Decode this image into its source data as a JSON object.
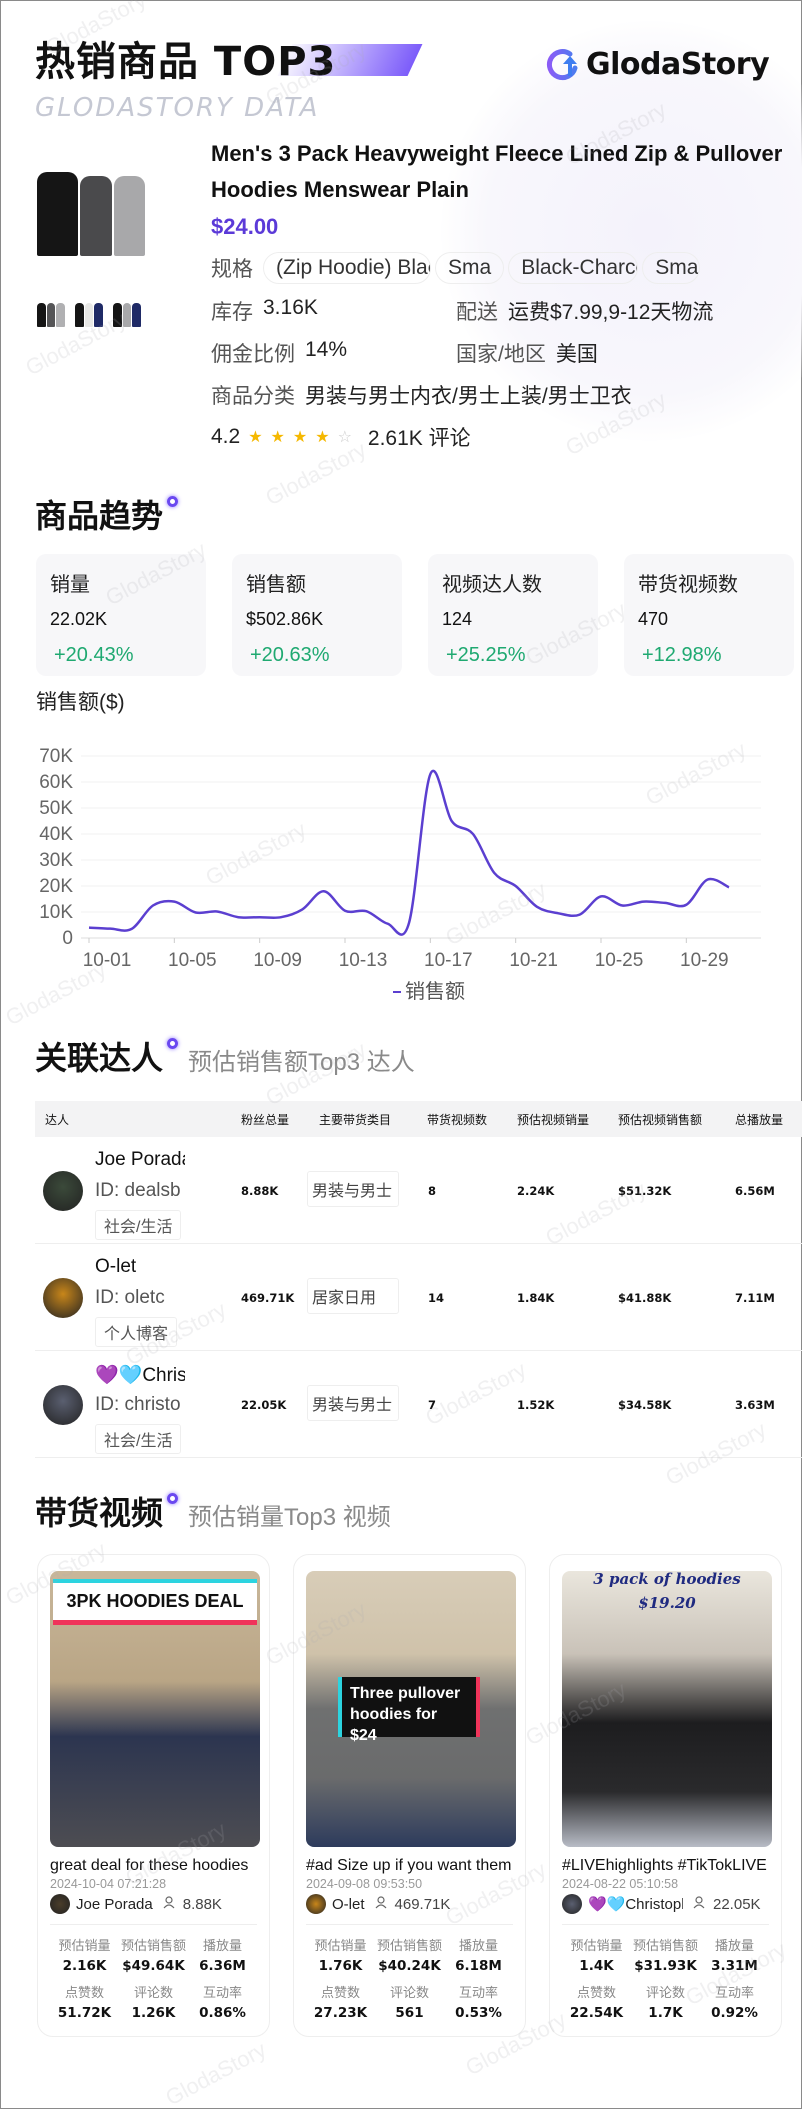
{
  "header": {
    "title": "热销商品 TOP3",
    "subtitle": "GLODASTORY DATA",
    "logo_text": "GlodaStory",
    "watermark": "GlodaStory",
    "accent_color": "#6a48f0"
  },
  "product": {
    "name": "Men's 3 Pack Heavyweight Fleece Lined Zip & Pullover Hoodies Menswear Plain",
    "price": "$24.00",
    "spec_label": "规格",
    "specs": [
      "(Zip Hoodie) Black-",
      "Sma",
      "Black-Charco",
      "Sma"
    ],
    "stock_label": "库存",
    "stock": "3.16K",
    "shipping_label": "配送",
    "shipping": "运费$7.99,9-12天物流",
    "commission_label": "佣金比例",
    "commission": "14%",
    "region_label": "国家/地区",
    "region": "美国",
    "category_label": "商品分类",
    "category": "男装与男士内衣/男士上装/男士卫衣",
    "rating": "4.2",
    "rating_stars": 4,
    "rating_max": 5,
    "reviews": "2.61K 评论",
    "image_colors": [
      "#151515",
      "#4a4a4c",
      "#a8a8aa"
    ],
    "variant_thumbs": [
      [
        "#151515",
        "#555557",
        "#b0b0b2"
      ],
      [
        "#151515",
        "#e8e8e6",
        "#1f2a66"
      ],
      [
        "#151515",
        "#a8a8aa",
        "#1f2a66"
      ]
    ]
  },
  "trend": {
    "title": "商品趋势",
    "metrics": [
      {
        "label": "销量",
        "value": "22.02K",
        "change": "+20.43%"
      },
      {
        "label": "销售额",
        "value": "$502.86K",
        "change": "+20.63%"
      },
      {
        "label": "视频达人数",
        "value": "124",
        "change": "+25.25%"
      },
      {
        "label": "带货视频数",
        "value": "470",
        "change": "+12.98%"
      }
    ],
    "positive_color": "#1fa971"
  },
  "chart_data": {
    "type": "line",
    "title": "销售额($)",
    "xlabel": "",
    "ylabel": "",
    "x": [
      "10-01",
      "10-02",
      "10-03",
      "10-04",
      "10-05",
      "10-06",
      "10-07",
      "10-08",
      "10-09",
      "10-10",
      "10-11",
      "10-12",
      "10-13",
      "10-14",
      "10-15",
      "10-16",
      "10-17",
      "10-18",
      "10-19",
      "10-20",
      "10-21",
      "10-22",
      "10-23",
      "10-24",
      "10-25",
      "10-26",
      "10-27",
      "10-28",
      "10-29",
      "10-30",
      "10-31"
    ],
    "x_tick_labels": [
      "10-01",
      "10-05",
      "10-09",
      "10-13",
      "10-17",
      "10-21",
      "10-25",
      "10-29"
    ],
    "y_tick_labels": [
      "0",
      "10K",
      "20K",
      "30K",
      "40K",
      "50K",
      "60K",
      "70K"
    ],
    "ylim": [
      0,
      70000
    ],
    "grid": true,
    "legend_position": "bottom",
    "series": [
      {
        "name": "销售额",
        "color": "#5b3fd0",
        "values": [
          4000,
          3600,
          3500,
          12500,
          14000,
          9800,
          10200,
          8000,
          8000,
          8000,
          11000,
          18000,
          10500,
          10300,
          5500,
          5800,
          63000,
          45000,
          40000,
          25000,
          20000,
          12000,
          9500,
          9000,
          16000,
          12500,
          14000,
          13500,
          12800,
          22500,
          19500
        ]
      }
    ]
  },
  "influencers": {
    "title": "关联达人",
    "subtitle": "预估销售额Top3 达人",
    "columns": [
      "达人",
      "粉丝总量",
      "主要带货类目",
      "带货视频数",
      "预估视频销量",
      "预估视频销售额",
      "总播放量"
    ],
    "rows": [
      {
        "name": "Joe Porada",
        "id": "ID: dealsb",
        "tag": "社会/生活",
        "fans": "8.88K",
        "category": "男装与男士",
        "videos": "8",
        "est_sales": "2.24K",
        "est_revenue": "$51.32K",
        "plays": "6.56M",
        "avatar_color": "#3b4a3a"
      },
      {
        "name": "O-let",
        "id": "ID: oletc",
        "tag": "个人博客",
        "fans": "469.71K",
        "category": "居家日用",
        "videos": "14",
        "est_sales": "1.84K",
        "est_revenue": "$41.88K",
        "plays": "7.11M",
        "avatar_color": "#c8861a"
      },
      {
        "name": "💜🩵Chris",
        "id": "ID: christo",
        "tag": "社会/生活",
        "fans": "22.05K",
        "category": "男装与男士",
        "videos": "7",
        "est_sales": "1.52K",
        "est_revenue": "$34.58K",
        "plays": "3.63M",
        "avatar_color": "#5a5f70"
      }
    ]
  },
  "videos": {
    "title": "带货视频",
    "subtitle": "预估销量Top3 视频",
    "stat_labels": [
      "预估销量",
      "预估销售额",
      "播放量",
      "点赞数",
      "评论数",
      "互动率"
    ],
    "items": [
      {
        "overlay": "3PK HOODIES DEAL",
        "title": "great deal for these hoodies",
        "date": "2024-10-04 07:21:28",
        "author": "Joe Porada",
        "fans": "8.88K",
        "stats": [
          "2.16K",
          "$49.64K",
          "6.36M",
          "51.72K",
          "1.26K",
          "0.86%"
        ]
      },
      {
        "overlay": "Three pullover hoodies for $24",
        "title": "#ad Size up if you want them",
        "date": "2024-09-08 09:53:50",
        "author": "O-let",
        "fans": "469.71K",
        "stats": [
          "1.76K",
          "$40.24K",
          "6.18M",
          "27.23K",
          "561",
          "0.53%"
        ]
      },
      {
        "overlay": "3 pack of hoodies $19.20",
        "title": "#LIVEhighlights #TikTokLIVE",
        "date": "2024-08-22 05:10:58",
        "author": "💜🩵Christopher",
        "fans": "22.05K",
        "stats": [
          "1.4K",
          "$31.93K",
          "3.31M",
          "22.54K",
          "1.7K",
          "0.92%"
        ]
      }
    ]
  }
}
